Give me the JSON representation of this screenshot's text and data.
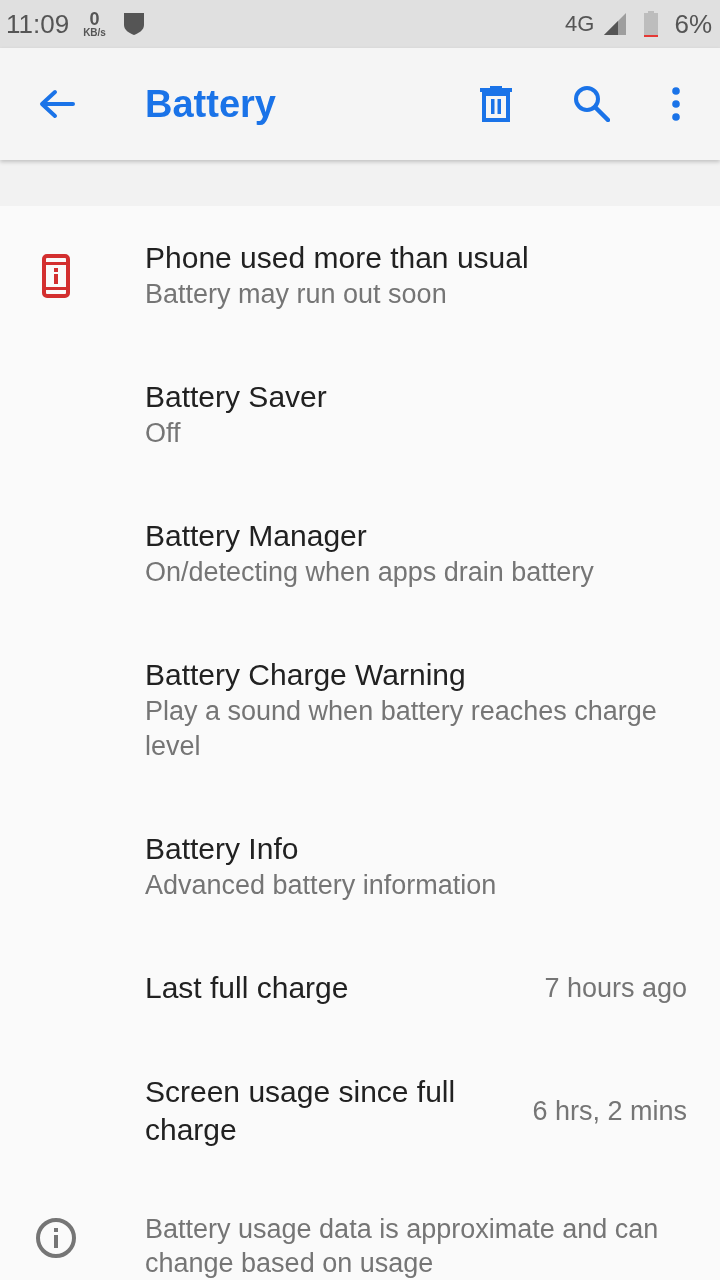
{
  "status_bar": {
    "time": "11:09",
    "net_speed": {
      "value": "0",
      "unit": "KB/s"
    },
    "network": "4G",
    "battery": "6%"
  },
  "app_bar": {
    "title": "Battery"
  },
  "items": [
    {
      "kind": "alert",
      "title": "Phone used more than usual",
      "summary": "Battery may run out soon"
    },
    {
      "kind": "setting",
      "title": "Battery Saver",
      "summary": "Off"
    },
    {
      "kind": "setting",
      "title": "Battery Manager",
      "summary": "On/detecting when apps drain battery"
    },
    {
      "kind": "setting",
      "title": "Battery Charge Warning",
      "summary": "Play a sound when battery reaches charge level"
    },
    {
      "kind": "setting",
      "title": "Battery Info",
      "summary": "Advanced battery information"
    },
    {
      "kind": "stat",
      "title": "Last full charge",
      "value": "7 hours ago"
    },
    {
      "kind": "stat",
      "title": "Screen usage since full charge",
      "value": "6 hrs, 2 mins"
    }
  ],
  "footer": {
    "text": "Battery usage data is approximate and can change based on usage"
  }
}
